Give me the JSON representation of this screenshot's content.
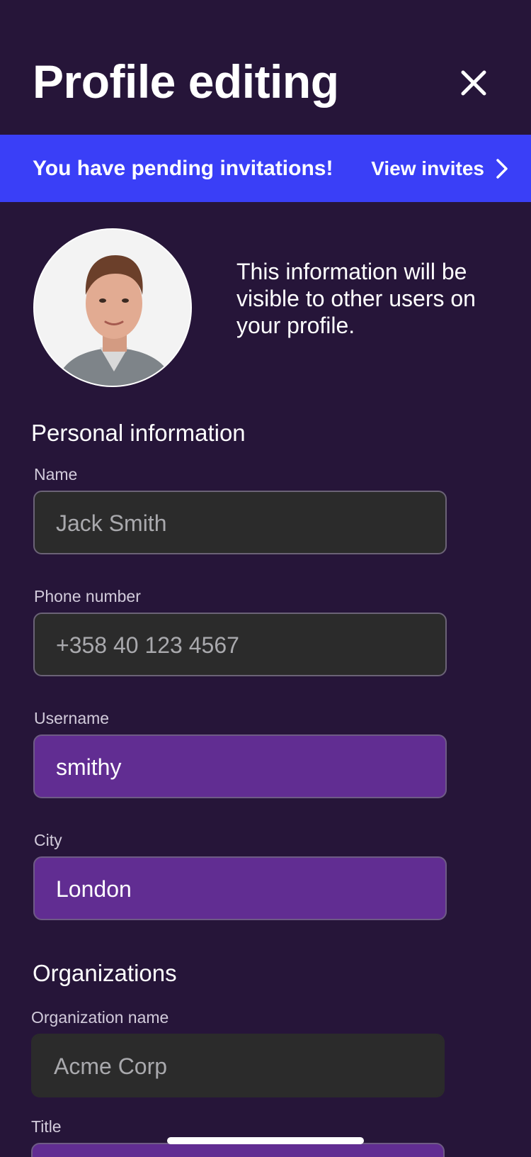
{
  "header": {
    "title": "Profile editing",
    "close_icon": "close-icon"
  },
  "banner": {
    "message": "You have pending invitations!",
    "action_label": "View invites",
    "action_icon": "chevron-right-icon",
    "background_color": "#3a3ff7"
  },
  "profile": {
    "avatar_icon": "avatar",
    "note": "This information will be visible to other users on your profile."
  },
  "personal": {
    "heading": "Personal information",
    "fields": [
      {
        "label": "Name",
        "value": "Jack Smith"
      },
      {
        "label": "Phone number",
        "value": "+358 40 123 4567"
      },
      {
        "label": "Username",
        "value": "smithy"
      },
      {
        "label": "City",
        "value": "London"
      }
    ]
  },
  "organizations": {
    "heading": "Organizations",
    "fields": [
      {
        "label": "Organization name",
        "value": "Acme Corp"
      },
      {
        "label": "Title",
        "value": ""
      }
    ]
  },
  "colors": {
    "background": "#261539",
    "field_inactive": "#2b2b2b",
    "field_active": "#612d92",
    "accent": "#3a3ff7"
  }
}
